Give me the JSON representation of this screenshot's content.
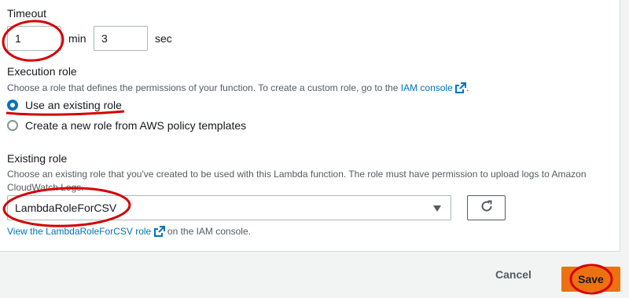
{
  "timeout": {
    "label": "Timeout",
    "minutes_value": "1",
    "minutes_unit": "min",
    "seconds_value": "3",
    "seconds_unit": "sec"
  },
  "execution_role": {
    "label": "Execution role",
    "description": "Choose a role that defines the permissions of your function. To create a custom role, go to the ",
    "description_link": "IAM console",
    "description_end": ".",
    "options": [
      {
        "label": "Use an existing role",
        "selected": true
      },
      {
        "label": "Create a new role from AWS policy templates",
        "selected": false
      }
    ]
  },
  "existing_role": {
    "label": "Existing role",
    "description": "Choose an existing role that you've created to be used with this Lambda function. The role must have permission to upload logs to Amazon CloudWatch Logs.",
    "selected_value": "LambdaRoleForCSV",
    "view_link": "View the LambdaRoleForCSV role",
    "view_link_suffix": " on the IAM console."
  },
  "footer": {
    "cancel_label": "Cancel",
    "save_label": "Save"
  },
  "colors": {
    "link": "#0073bb",
    "primary_button": "#ec7211",
    "annotation": "#d40000"
  }
}
